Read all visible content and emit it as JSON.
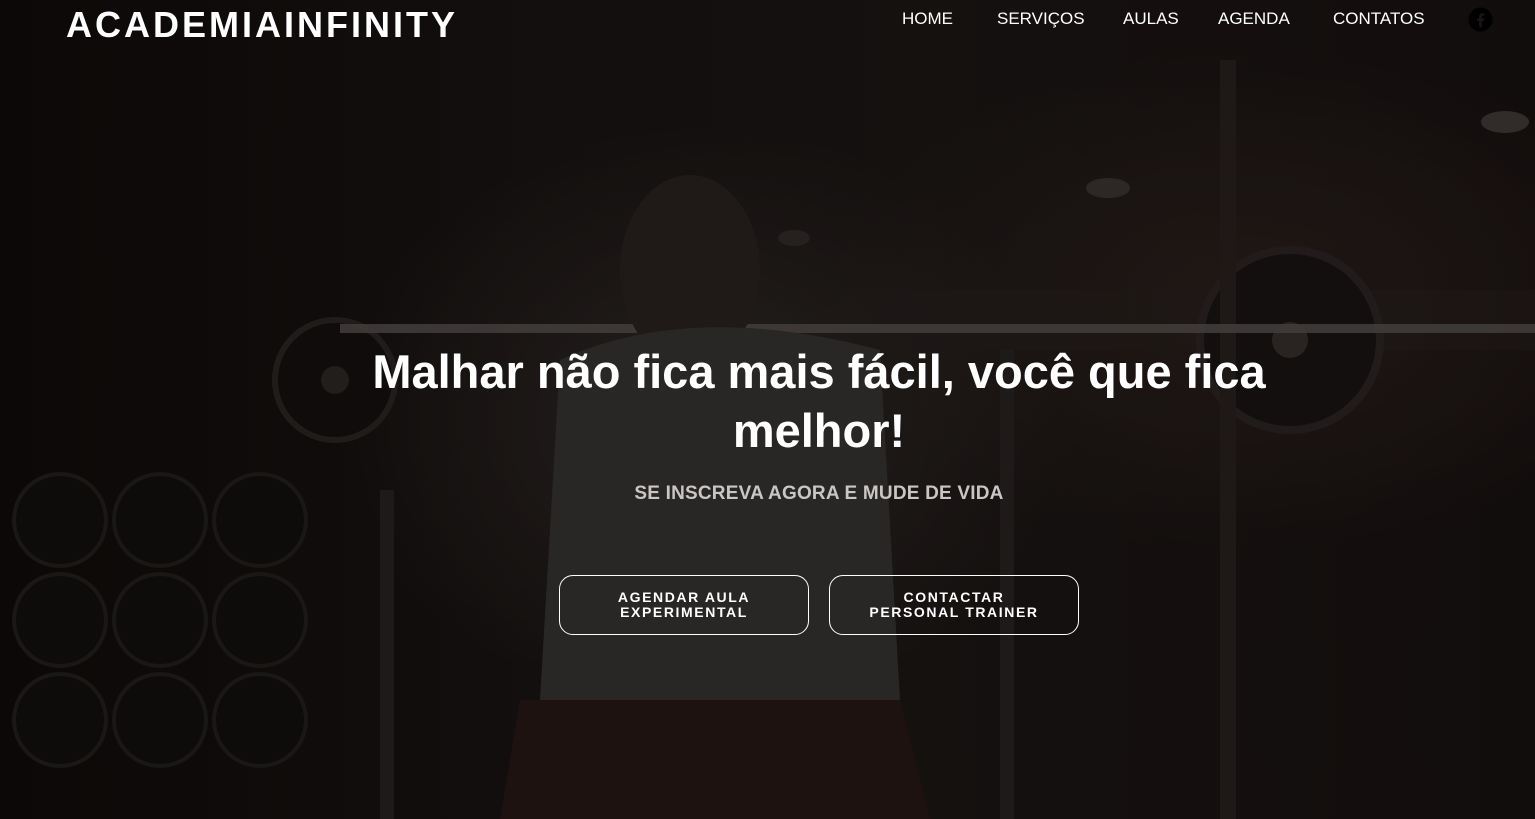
{
  "header": {
    "logo": "ACADEMIAINFINITY",
    "nav": [
      {
        "label": "HOME"
      },
      {
        "label": "SERVIÇOS"
      },
      {
        "label": "AULAS"
      },
      {
        "label": "AGENDA"
      },
      {
        "label": "CONTATOS"
      }
    ],
    "social_icon": "facebook-icon"
  },
  "hero": {
    "headline": "Malhar não fica mais fácil, você que fica melhor!",
    "subheadline": "SE INSCREVA AGORA E MUDE DE VIDA",
    "buttons": [
      {
        "label": "AGENDAR AULA EXPERIMENTAL"
      },
      {
        "label": "CONTACTAR PERSONAL TRAINER"
      }
    ]
  },
  "colors": {
    "text": "#ffffff",
    "subtext": "#c9c6c4",
    "background": "#110c0b"
  }
}
